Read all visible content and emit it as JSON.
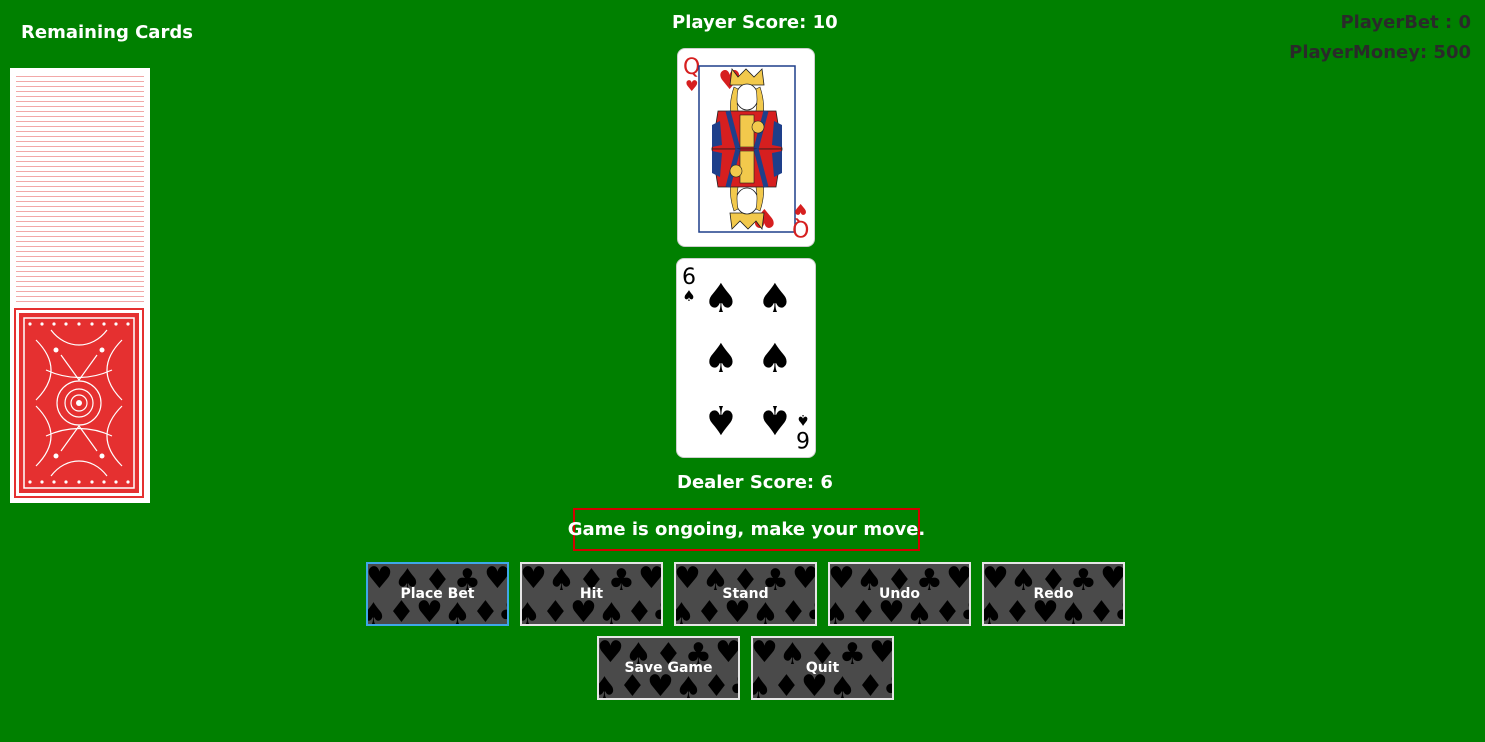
{
  "deck": {
    "title": "Remaining Cards"
  },
  "player": {
    "score_label": "Player Score: 10",
    "card": {
      "rank": "Q",
      "suit": "hearts",
      "suit_glyph": "♥",
      "color": "#d61f1f"
    }
  },
  "dealer": {
    "score_label": "Dealer Score: 6",
    "card": {
      "rank": "6",
      "suit": "spades",
      "suit_glyph": "♠",
      "color": "#000000"
    }
  },
  "stats": {
    "bet_label": "PlayerBet : 0",
    "money_label": "PlayerMoney: 500"
  },
  "status": {
    "message": "Game is ongoing, make your move."
  },
  "buttons": {
    "place_bet": "Place Bet",
    "hit": "Hit",
    "stand": "Stand",
    "undo": "Undo",
    "redo": "Redo",
    "save_game": "Save Game",
    "quit": "Quit"
  },
  "colors": {
    "table": "#008000",
    "status_border": "#d40000",
    "button_bg": "#4a4a4a",
    "button_focus": "#3fa7e8",
    "card_back": "#e53030"
  },
  "icons": {
    "button_pattern": "card-suits-pattern-icon",
    "deck_back": "card-back-pattern-icon"
  }
}
